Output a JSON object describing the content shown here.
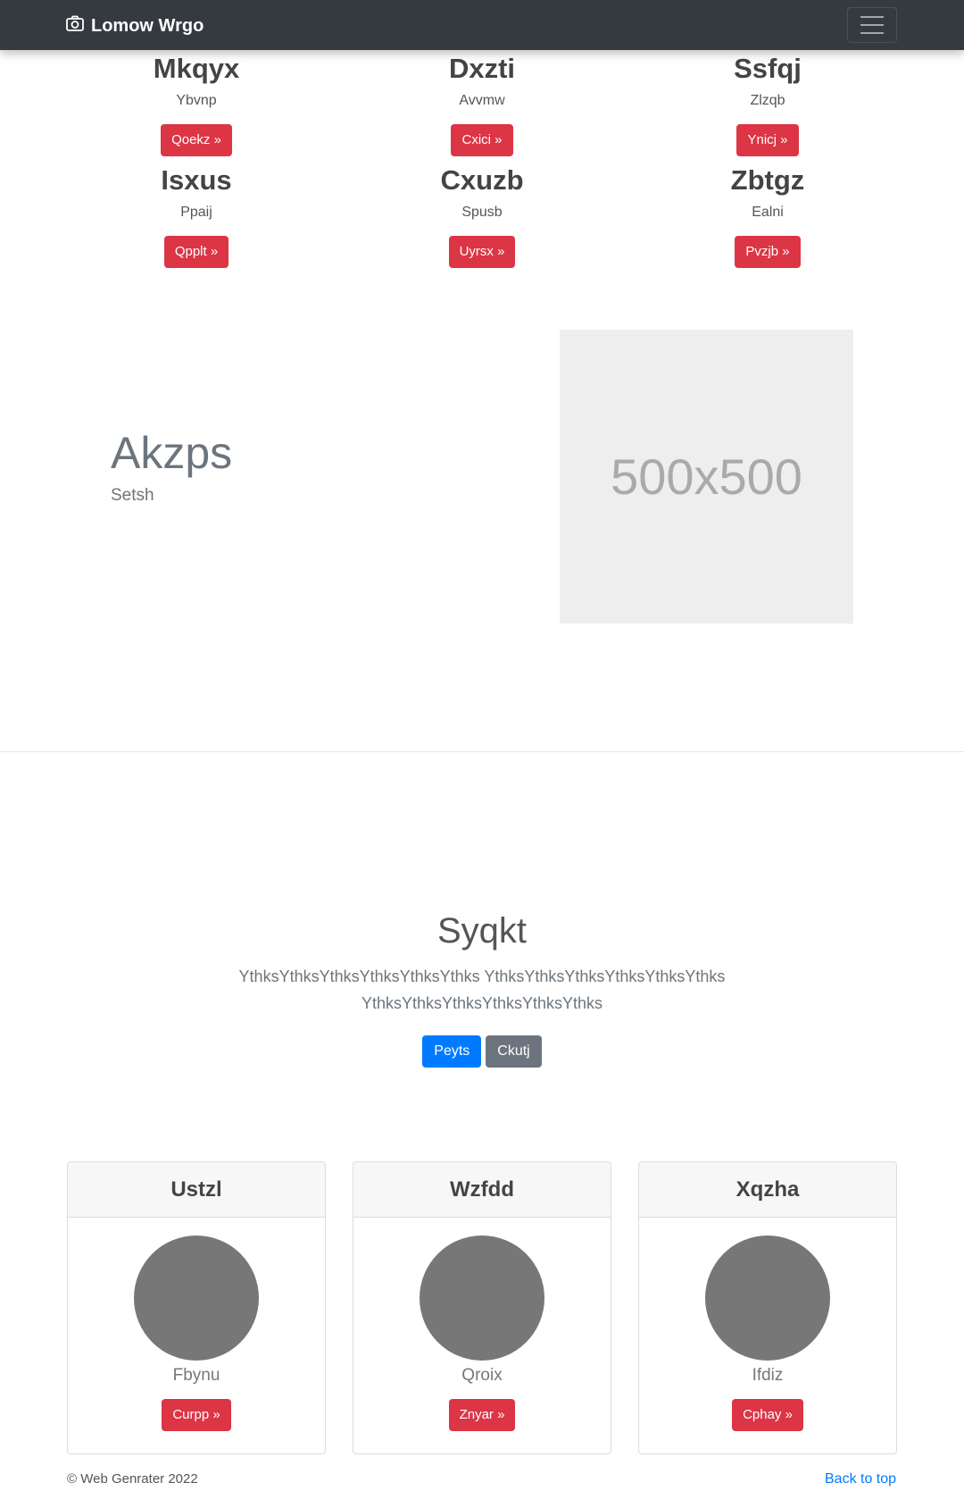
{
  "navbar": {
    "brand": "Lomow Wrgo"
  },
  "features": [
    {
      "title": "Mkqyx",
      "text": "Ybvnp",
      "button": "Qoekz »"
    },
    {
      "title": "Dxzti",
      "text": "Avvmw",
      "button": "Cxici »"
    },
    {
      "title": "Ssfqj",
      "text": "Zlzqb",
      "button": "Ynicj »"
    },
    {
      "title": "Isxus",
      "text": "Ppaij",
      "button": "Qpplt »"
    },
    {
      "title": "Cxuzb",
      "text": "Spusb",
      "button": "Uyrsx »"
    },
    {
      "title": "Zbtgz",
      "text": "Ealni",
      "button": "Pvzjb »"
    }
  ],
  "featurette": {
    "title": "Akzps",
    "subtitle": "Setsh",
    "image_label": "500x500"
  },
  "jumbotron": {
    "title": "Syqkt",
    "lead": "YthksYthksYthksYthksYthksYthks YthksYthksYthksYthksYthksYthks YthksYthksYthksYthksYthksYthks",
    "primary_button": "Peyts",
    "secondary_button": "Ckutj"
  },
  "cards": [
    {
      "header": "Ustzl",
      "name": "Fbynu",
      "button": "Curpp »"
    },
    {
      "header": "Wzfdd",
      "name": "Qroix",
      "button": "Znyar »"
    },
    {
      "header": "Xqzha",
      "name": "Ifdiz",
      "button": "Cphay »"
    }
  ],
  "footer": {
    "copyright": "© Web Genrater 2022",
    "back_to_top": "Back to top"
  },
  "colors": {
    "navbar": "#343a40",
    "danger": "#dc3545",
    "primary": "#007bff",
    "secondary": "#6c757d"
  }
}
